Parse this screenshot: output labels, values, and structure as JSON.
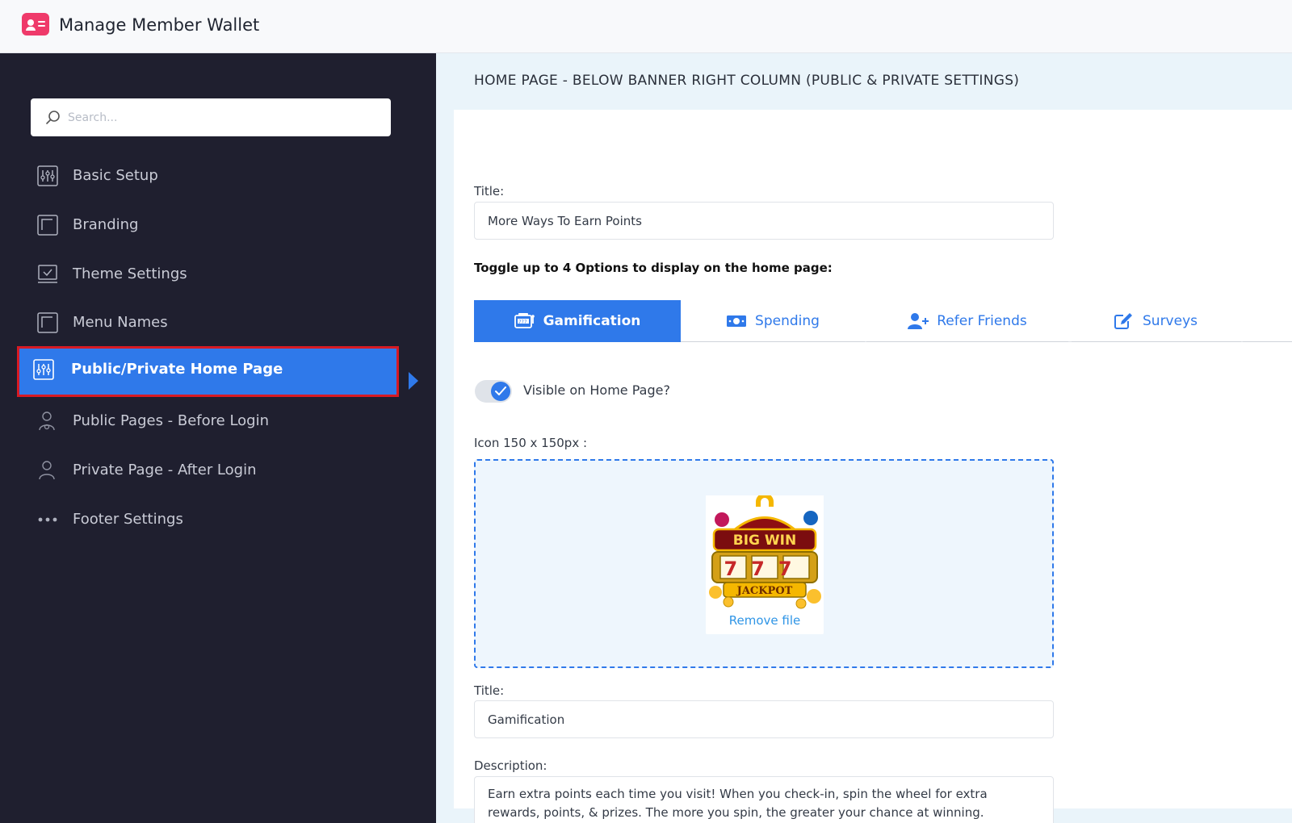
{
  "app": {
    "title": "Manage Member Wallet",
    "logo_icon": "member-card-icon"
  },
  "sidebar": {
    "search_placeholder": "Search...",
    "items": [
      {
        "label": "Basic Setup",
        "icon": "sliders-icon",
        "active": false
      },
      {
        "label": "Branding",
        "icon": "frame-icon",
        "active": false
      },
      {
        "label": "Theme Settings",
        "icon": "monitor-check-icon",
        "active": false
      },
      {
        "label": "Menu Names",
        "icon": "frame-icon",
        "active": false
      },
      {
        "label": "Public/Private Home Page",
        "icon": "sliders-icon",
        "active": true
      },
      {
        "label": "Public Pages - Before Login",
        "icon": "user-gear-icon",
        "active": false
      },
      {
        "label": "Private Page - After Login",
        "icon": "user-icon",
        "active": false
      },
      {
        "label": "Footer Settings",
        "icon": "dots-icon",
        "active": false
      }
    ]
  },
  "main": {
    "section_title": "HOME PAGE - BELOW BANNER RIGHT COLUMN (PUBLIC & PRIVATE SETTINGS)",
    "title_label": "Title:",
    "title_value": "More Ways To Earn Points",
    "toggle_instruction": "Toggle up to 4 Options to display on the home page:",
    "tabs": [
      {
        "label": "Gamification",
        "icon": "slot-machine-icon",
        "active": true
      },
      {
        "label": "Spending",
        "icon": "money-icon",
        "active": false
      },
      {
        "label": "Refer Friends",
        "icon": "user-plus-icon",
        "active": false
      },
      {
        "label": "Surveys",
        "icon": "edit-icon",
        "active": false
      }
    ],
    "visible_label": "Visible on Home Page?",
    "visible_on": true,
    "icon_label": "Icon 150 x 150px :",
    "preview_image_text": [
      "BIG WIN",
      "777",
      "JACKPOT"
    ],
    "remove_file": "Remove file",
    "item_title_label": "Title:",
    "item_title_value": "Gamification",
    "description_label": "Description:",
    "description_value": "Earn extra points each time you visit! When you check-in, spin the wheel for extra rewards, points, & prizes. The more you spin, the greater your chance at winning."
  },
  "colors": {
    "accent": "#2f79ea",
    "sidebar_bg": "#1f1f2f",
    "highlight_border": "#d71a24",
    "logo": "#ef3a6a"
  }
}
